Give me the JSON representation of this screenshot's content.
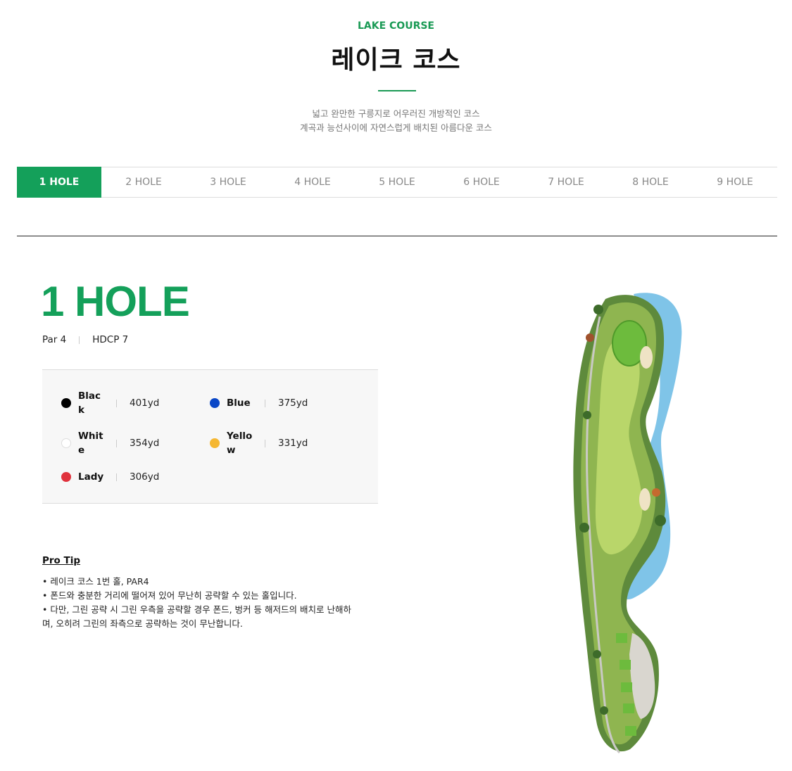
{
  "header": {
    "course_en": "LAKE COURSE",
    "course_ko": "레이크 코스",
    "desc_line1": "넓고 완만한 구릉지로 어우러진 개방적인  코스",
    "desc_line2": "계곡과 능선사이에 자연스럽게 배치된 아름다운 코스"
  },
  "tabs": [
    "1 HOLE",
    "2 HOLE",
    "3 HOLE",
    "4 HOLE",
    "5 HOLE",
    "6 HOLE",
    "7 HOLE",
    "8 HOLE",
    "9 HOLE"
  ],
  "active_tab": "1 HOLE",
  "hole": {
    "title": "1 HOLE",
    "par": "Par 4",
    "hdcp": "HDCP 7"
  },
  "tees": [
    {
      "name": "Black",
      "yardage": "401yd",
      "color": "#000000"
    },
    {
      "name": "Blue",
      "yardage": "375yd",
      "color": "#0a47c7"
    },
    {
      "name": "White",
      "yardage": "354yd",
      "color": "#ffffff"
    },
    {
      "name": "Yellow",
      "yardage": "331yd",
      "color": "#f5b731"
    },
    {
      "name": "Lady",
      "yardage": "306yd",
      "color": "#e0323c"
    }
  ],
  "protip": {
    "title": "Pro Tip",
    "lines": [
      "• 레이크 코스 1번 홀, PAR4",
      "• 폰드와 충분한 거리에 떨어져 있어 무난히 공략할 수 있는 홀입니다.",
      "• 다만, 그린 공략 시 그린 우측을 공략할 경우 폰드, 벙커 등 해저드의 배치로 난해하며, 오히려 그린의 좌측으로 공략하는 것이 무난합니다."
    ]
  },
  "colors": {
    "accent": "#14a05a",
    "water": "#7fc4e8",
    "fairway": "#b9d66a",
    "rough": "#8fb550",
    "green": "#6dbb3d",
    "sand": "#efe3c5"
  }
}
